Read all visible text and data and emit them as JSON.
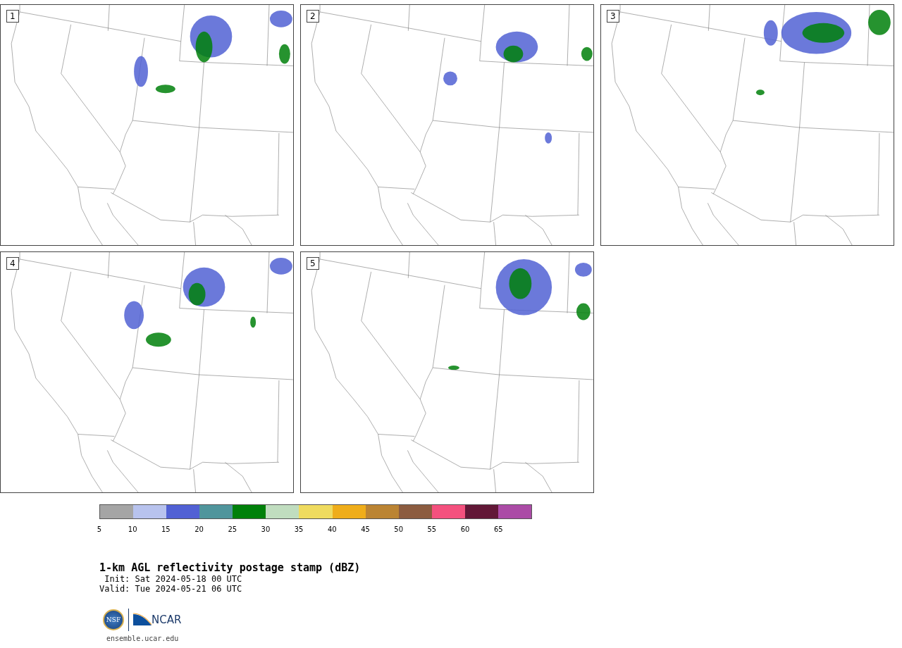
{
  "panels": [
    {
      "number": "1"
    },
    {
      "number": "2"
    },
    {
      "number": "3"
    },
    {
      "number": "4"
    },
    {
      "number": "5"
    }
  ],
  "colorbar": {
    "segments": [
      {
        "color": "#a5a5a5"
      },
      {
        "color": "#b8c3ee"
      },
      {
        "color": "#5161d4"
      },
      {
        "color": "#50959c"
      },
      {
        "color": "#00800a"
      },
      {
        "color": "#c0ddbf"
      },
      {
        "color": "#efdb5f"
      },
      {
        "color": "#efad1a"
      },
      {
        "color": "#bb8433"
      },
      {
        "color": "#8c5c40"
      },
      {
        "color": "#f4517e"
      },
      {
        "color": "#621837"
      },
      {
        "color": "#ab4ba6"
      }
    ],
    "ticks": [
      "5",
      "10",
      "15",
      "20",
      "25",
      "30",
      "35",
      "40",
      "45",
      "50",
      "55",
      "60",
      "65"
    ]
  },
  "title": "1-km AGL reflectivity postage stamp (dBZ)",
  "init": "Init: Sat 2024-05-18 00 UTC",
  "valid": "Valid: Tue 2024-05-21 06 UTC",
  "logo": {
    "left": "NSF",
    "right": "NCAR"
  },
  "url": "ensemble.ucar.edu"
}
